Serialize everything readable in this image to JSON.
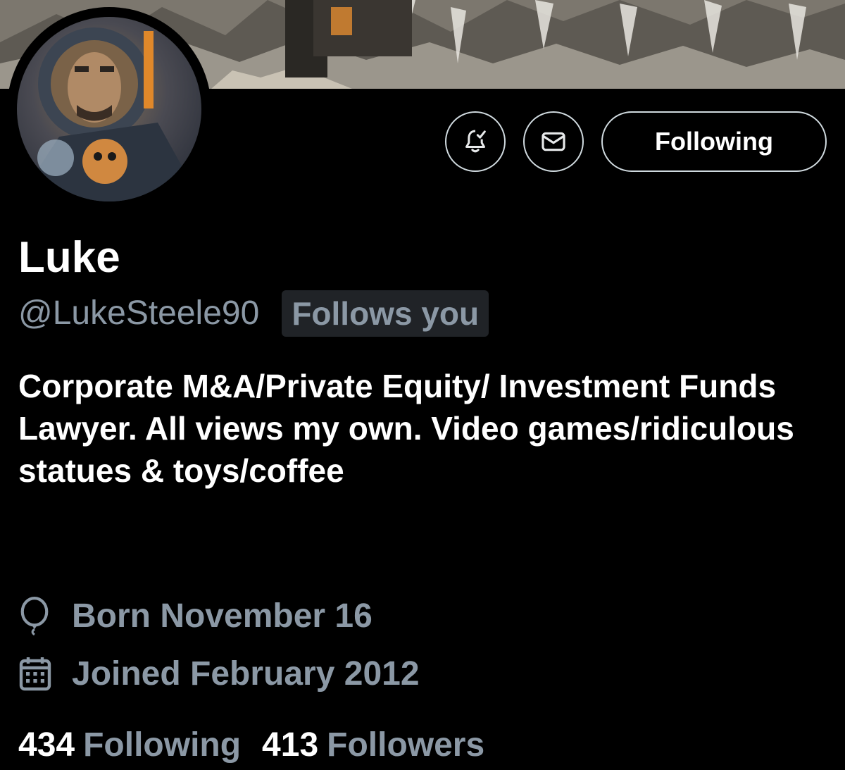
{
  "header": {
    "banner": "mountain-landscape-banner",
    "avatar": "astronaut-avatar"
  },
  "actions": {
    "notify_icon": "bell-check-icon",
    "message_icon": "envelope-icon",
    "following_label": "Following"
  },
  "profile": {
    "name": "Luke",
    "handle": "@LukeSteele90",
    "follows_you": "Follows you",
    "bio": "Corporate M&A/Private Equity/ Investment Funds Lawyer. All views my own. Video games/ridiculous statues & toys/coffee",
    "born": "Born November 16",
    "joined": "Joined February 2012"
  },
  "stats": {
    "following_count": "434",
    "following_label": "Following",
    "followers_count": "413",
    "followers_label": "Followers"
  },
  "colors": {
    "background": "#000000",
    "primary_text": "#ffffff",
    "secondary_text": "#8b98a5",
    "border": "#cfd9de",
    "badge_bg": "#202327"
  }
}
